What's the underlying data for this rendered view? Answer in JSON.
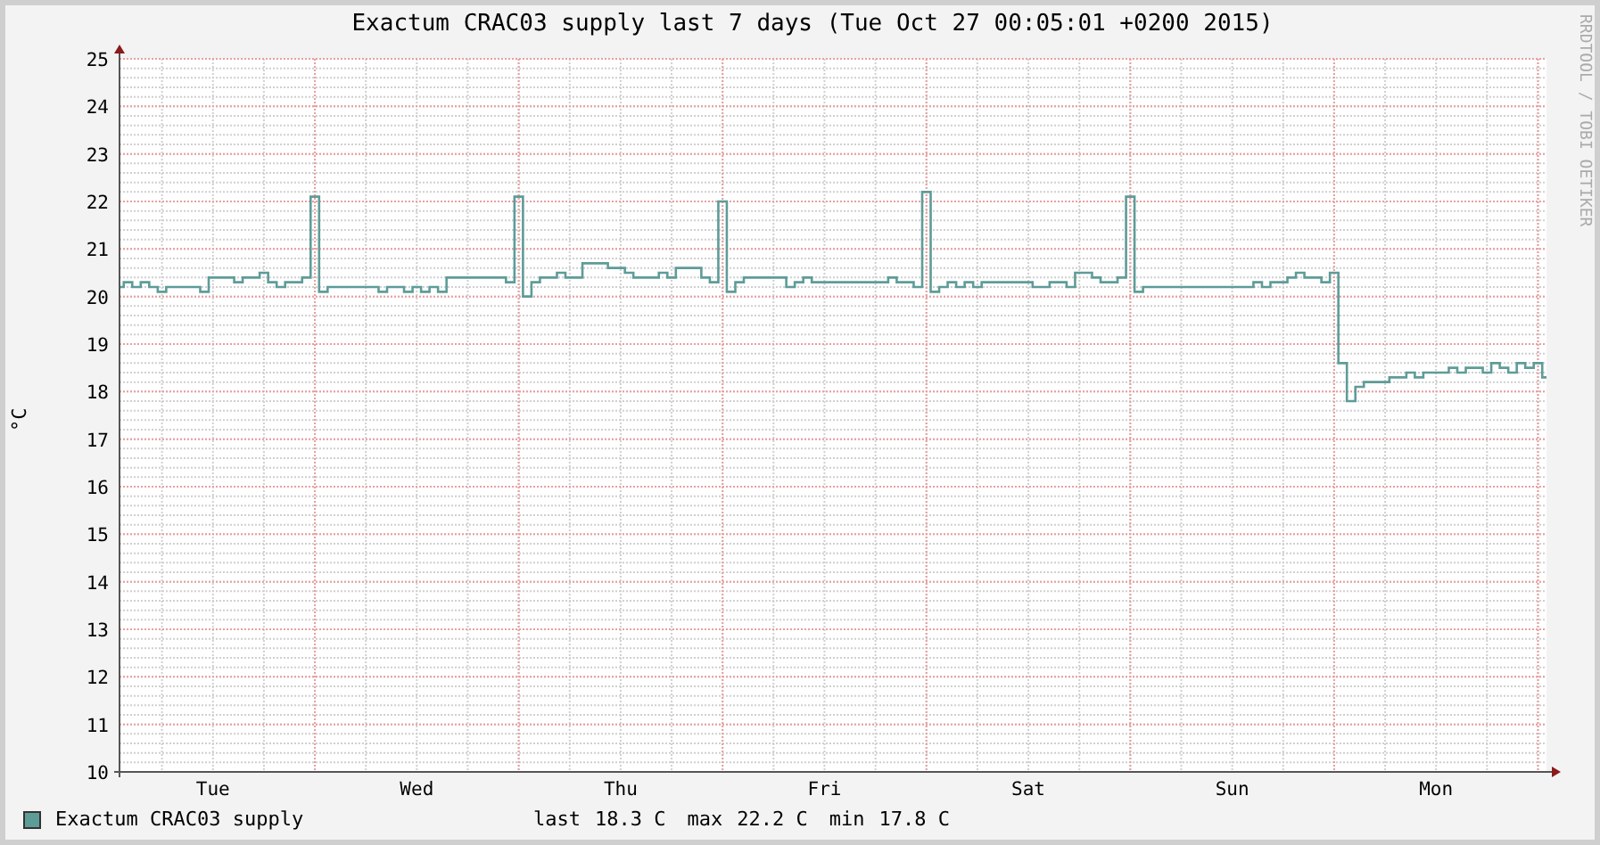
{
  "title": "Exactum CRAC03 supply last 7 days (Tue Oct 27 00:05:01 +0200 2015)",
  "credit": "RRDTOOL / TOBI OETIKER",
  "chart_data": {
    "type": "line",
    "ylabel": "°C",
    "ylim": [
      10,
      25
    ],
    "grid": true,
    "yticks": [
      10,
      11,
      12,
      13,
      14,
      15,
      16,
      17,
      18,
      19,
      20,
      21,
      22,
      23,
      24,
      25
    ],
    "categories": [
      null,
      null,
      null,
      null,
      null,
      null,
      null,
      null,
      null,
      null,
      null,
      "Tue",
      null,
      null,
      null,
      null,
      null,
      null,
      null,
      null,
      null,
      null,
      null,
      null,
      null,
      null,
      null,
      null,
      null,
      null,
      null,
      null,
      null,
      null,
      null,
      "Wed",
      null,
      null,
      null,
      null,
      null,
      null,
      null,
      null,
      null,
      null,
      null,
      null,
      null,
      null,
      null,
      null,
      null,
      null,
      null,
      null,
      null,
      null,
      null,
      "Thu",
      null,
      null,
      null,
      null,
      null,
      null,
      null,
      null,
      null,
      null,
      null,
      null,
      null,
      null,
      null,
      null,
      null,
      null,
      null,
      null,
      null,
      null,
      null,
      "Fri",
      null,
      null,
      null,
      null,
      null,
      null,
      null,
      null,
      null,
      null,
      null,
      null,
      null,
      null,
      null,
      null,
      null,
      null,
      null,
      null,
      null,
      null,
      null,
      "Sat",
      null,
      null,
      null,
      null,
      null,
      null,
      null,
      null,
      null,
      null,
      null,
      null,
      null,
      null,
      null,
      null,
      null,
      null,
      null,
      null,
      null,
      null,
      null,
      "Sun",
      null,
      null,
      null,
      null,
      null,
      null,
      null,
      null,
      null,
      null,
      null,
      null,
      null,
      null,
      null,
      null,
      null,
      null,
      null,
      null,
      null,
      null,
      null,
      "Mon",
      null,
      null,
      null,
      null,
      null,
      null,
      null,
      null,
      null,
      null,
      null,
      null,
      null
    ],
    "series": [
      {
        "name": "Exactum CRAC03 supply",
        "color": "#5e9c98",
        "values": [
          20.2,
          20.3,
          20.2,
          20.3,
          20.2,
          20.1,
          20.2,
          20.2,
          20.2,
          20.2,
          20.1,
          20.4,
          20.4,
          20.4,
          20.3,
          20.4,
          20.4,
          20.5,
          20.3,
          20.2,
          20.3,
          20.3,
          20.4,
          22.1,
          20.1,
          20.2,
          20.2,
          20.2,
          20.2,
          20.2,
          20.2,
          20.1,
          20.2,
          20.2,
          20.1,
          20.2,
          20.1,
          20.2,
          20.1,
          20.4,
          20.4,
          20.4,
          20.4,
          20.4,
          20.4,
          20.4,
          20.3,
          22.1,
          20.0,
          20.3,
          20.4,
          20.4,
          20.5,
          20.4,
          20.4,
          20.7,
          20.7,
          20.7,
          20.6,
          20.6,
          20.5,
          20.4,
          20.4,
          20.4,
          20.5,
          20.4,
          20.6,
          20.6,
          20.6,
          20.4,
          20.3,
          22.0,
          20.1,
          20.3,
          20.4,
          20.4,
          20.4,
          20.4,
          20.4,
          20.2,
          20.3,
          20.4,
          20.3,
          20.3,
          20.3,
          20.3,
          20.3,
          20.3,
          20.3,
          20.3,
          20.3,
          20.4,
          20.3,
          20.3,
          20.2,
          22.2,
          20.1,
          20.2,
          20.3,
          20.2,
          20.3,
          20.2,
          20.3,
          20.3,
          20.3,
          20.3,
          20.3,
          20.3,
          20.2,
          20.2,
          20.3,
          20.3,
          20.2,
          20.5,
          20.5,
          20.4,
          20.3,
          20.3,
          20.4,
          22.1,
          20.1,
          20.2,
          20.2,
          20.2,
          20.2,
          20.2,
          20.2,
          20.2,
          20.2,
          20.2,
          20.2,
          20.2,
          20.2,
          20.2,
          20.3,
          20.2,
          20.3,
          20.3,
          20.4,
          20.5,
          20.4,
          20.4,
          20.3,
          20.5,
          18.6,
          17.8,
          18.1,
          18.2,
          18.2,
          18.2,
          18.3,
          18.3,
          18.4,
          18.3,
          18.4,
          18.4,
          18.4,
          18.5,
          18.4,
          18.5,
          18.5,
          18.4,
          18.6,
          18.5,
          18.4,
          18.6,
          18.5,
          18.6,
          18.3
        ]
      }
    ]
  },
  "legend_stats": [
    {
      "label": "last",
      "value": "18.3 C"
    },
    {
      "label": "max",
      "value": "22.2 C"
    },
    {
      "label": "min",
      "value": "17.8 C"
    }
  ]
}
